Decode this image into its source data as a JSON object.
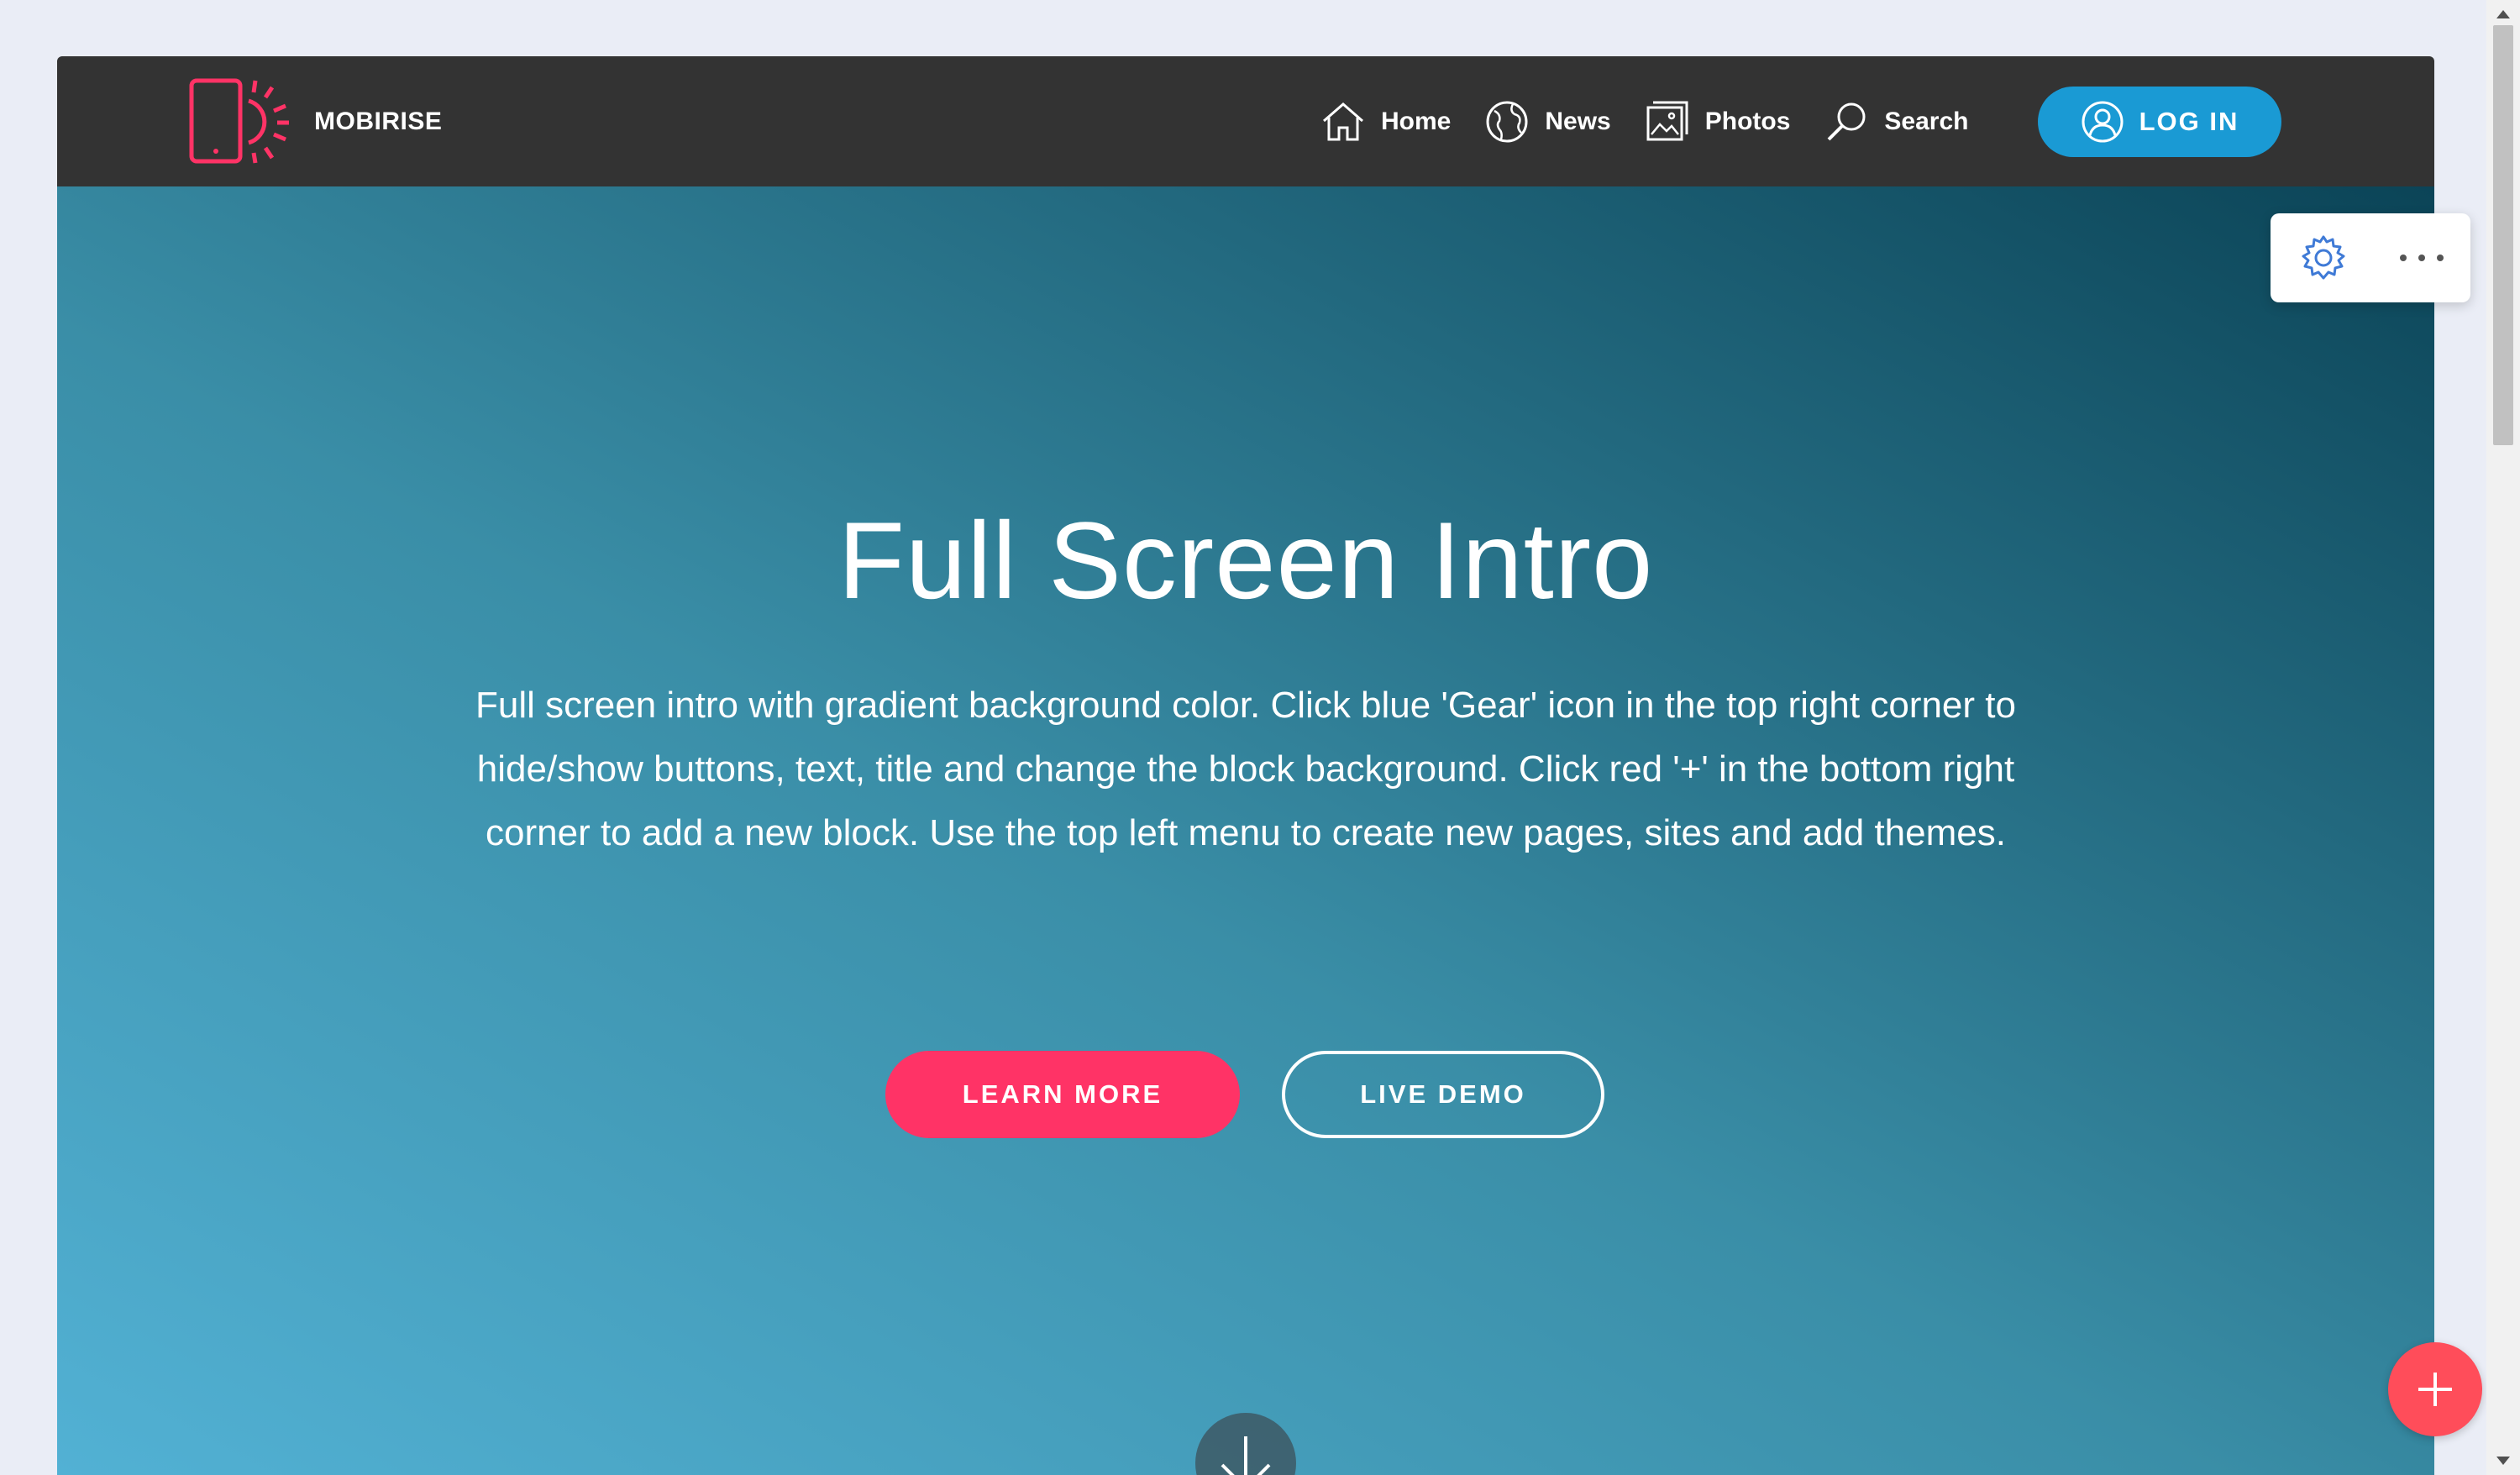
{
  "navbar": {
    "brand": "MOBIRISE",
    "items": [
      {
        "label": "Home",
        "icon": "home-icon"
      },
      {
        "label": "News",
        "icon": "globe-icon"
      },
      {
        "label": "Photos",
        "icon": "photos-icon"
      },
      {
        "label": "Search",
        "icon": "search-icon"
      }
    ],
    "login_label": "LOG IN"
  },
  "hero": {
    "title": "Full Screen Intro",
    "text": "Full screen intro with gradient background color. Click blue 'Gear' icon in the top right corner to hide/show buttons, text, title and change the block background. Click red '+' in the bottom right corner to add a new block. Use the top left menu to create new pages, sites and add themes.",
    "primary_button": "LEARN MORE",
    "secondary_button": "LIVE DEMO"
  },
  "colors": {
    "navbar_bg": "#333333",
    "brand_accent": "#ff3366",
    "login_bg": "#1a9ad4",
    "primary_button_bg": "#ff3366",
    "add_button_bg": "#ff4d5a",
    "gear_icon": "#3f7ad6"
  },
  "icons": {
    "block_settings": "gear-icon",
    "block_more": "more-dots-icon",
    "add_block": "plus-icon",
    "scroll_down": "arrow-down-icon",
    "login": "user-icon",
    "brand": "mobile-sun-logo-icon"
  }
}
